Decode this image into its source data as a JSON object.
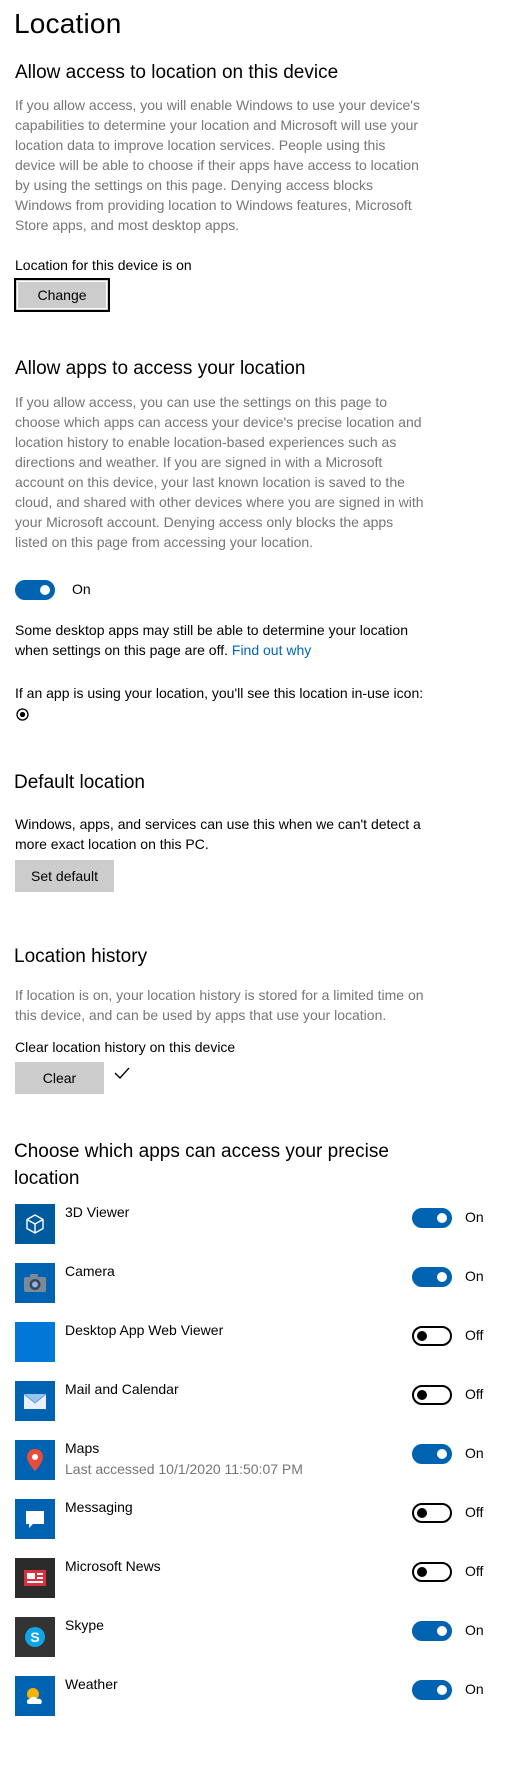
{
  "page": {
    "title": "Location"
  },
  "device_section": {
    "heading": "Allow access to location on this device",
    "description": "If you allow access, you will enable Windows to use your device's capabilities to determine your location and Microsoft will use your location data to improve location services. People using this device will be able to choose if their apps have access to location by using the settings on this page. Denying access blocks Windows from providing location to Windows features, Microsoft Store apps, and most desktop apps.",
    "status": "Location for this device is on",
    "change_label": "Change"
  },
  "apps_section": {
    "heading": "Allow apps to access your location",
    "description": "If you allow access, you can use the settings on this page to choose which apps can access your device's precise location and location history to enable location-based experiences such as directions and weather. If you are signed in with a Microsoft account on this device, your last known location is saved to the cloud, and shared with other devices where you are signed in with your Microsoft account. Denying access only blocks the apps listed on this page from accessing your location.",
    "toggle_state": "On",
    "desktop_note": "Some desktop apps may still be able to determine your location when settings on this page are off.",
    "find_out_why": "Find out why",
    "in_use_note": "If an app is using your location, you'll see this location in-use icon:"
  },
  "default_location": {
    "heading": "Default location",
    "description": "Windows, apps, and services can use this when we can't detect a more exact location on this PC.",
    "button_label": "Set default"
  },
  "history": {
    "heading": "Location history",
    "description": "If location is on, your location history is stored for a limited time on this device, and can be used by apps that use your location.",
    "clear_label_text": "Clear location history on this device",
    "clear_button": "Clear",
    "done_icon": "checkmark-icon"
  },
  "apps_list": {
    "heading": "Choose which apps can access your precise location",
    "apps": [
      {
        "name": "3D Viewer",
        "subtitle": "",
        "state": "On",
        "on": true,
        "icon": "cube-icon",
        "color": "#005a9e"
      },
      {
        "name": "Camera",
        "subtitle": "",
        "state": "On",
        "on": true,
        "icon": "camera-icon",
        "color": "#0063b1"
      },
      {
        "name": "Desktop App Web Viewer",
        "subtitle": "",
        "state": "Off",
        "on": false,
        "icon": "blank-app-icon",
        "color": "#0078d7"
      },
      {
        "name": "Mail and Calendar",
        "subtitle": "",
        "state": "Off",
        "on": false,
        "icon": "mail-icon",
        "color": "#0063b1"
      },
      {
        "name": "Maps",
        "subtitle": "Last accessed 10/1/2020 11:50:07 PM",
        "state": "On",
        "on": true,
        "icon": "map-pin-icon",
        "color": "#0063b1"
      },
      {
        "name": "Messaging",
        "subtitle": "",
        "state": "Off",
        "on": false,
        "icon": "chat-bubble-icon",
        "color": "#0063b1"
      },
      {
        "name": "Microsoft News",
        "subtitle": "",
        "state": "Off",
        "on": false,
        "icon": "news-icon",
        "color": "#2b2b2b"
      },
      {
        "name": "Skype",
        "subtitle": "",
        "state": "On",
        "on": true,
        "icon": "skype-icon",
        "color": "#333333"
      },
      {
        "name": "Weather",
        "subtitle": "",
        "state": "On",
        "on": true,
        "icon": "weather-icon",
        "color": "#0063b1"
      }
    ]
  }
}
